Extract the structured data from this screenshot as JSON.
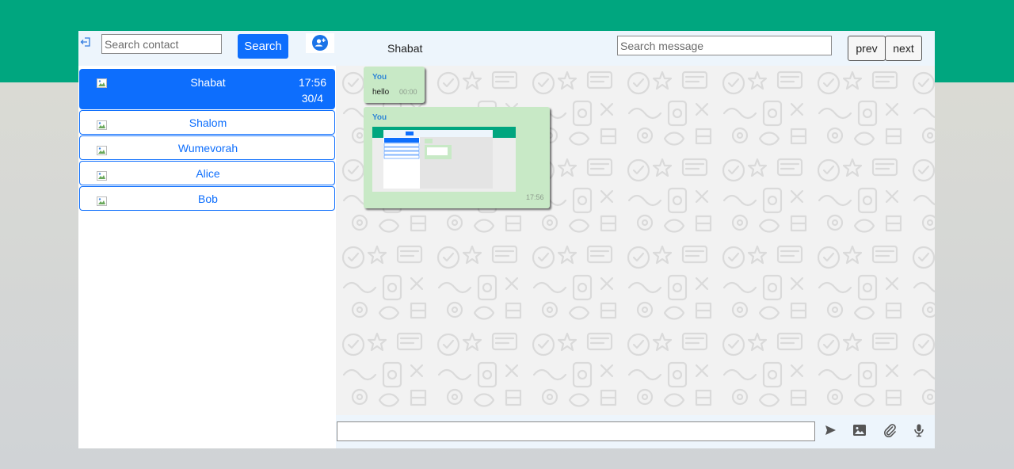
{
  "sidebar": {
    "search": {
      "placeholder": "Search contact",
      "value": ""
    },
    "search_button": "Search",
    "contacts": [
      {
        "name": "Shabat",
        "time": "17:56",
        "date": "30/4",
        "active": true
      },
      {
        "name": "Shalom"
      },
      {
        "name": "Wumevorah"
      },
      {
        "name": "Alice"
      },
      {
        "name": "Bob"
      }
    ]
  },
  "chat": {
    "contact_name": "Shabat",
    "search": {
      "placeholder": "Search message",
      "value": ""
    },
    "prev_label": "prev",
    "next_label": "next",
    "messages": [
      {
        "sender": "You",
        "text": "hello",
        "time": "00:00"
      },
      {
        "sender": "You",
        "time": "17:56"
      }
    ],
    "input": {
      "value": ""
    }
  },
  "colors": {
    "accent": "#0d6efd",
    "brand": "#00a67f",
    "bubble": "#c8e9c6"
  }
}
